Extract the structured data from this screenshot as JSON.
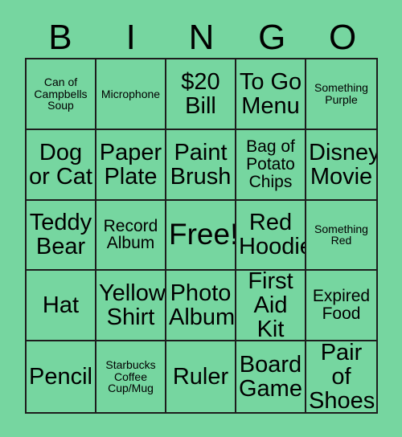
{
  "card": {
    "title": "BINGO",
    "background_color": "#76d6a0",
    "grid_line_color": "#1d1d1d",
    "text_color": "#000000",
    "header_letters": [
      "B",
      "I",
      "N",
      "G",
      "O"
    ],
    "rows": [
      [
        {
          "label": "Can of Campbells Soup",
          "size": "sm"
        },
        {
          "label": "Microphone",
          "size": "sm"
        },
        {
          "label": "$20 Bill",
          "size": "lg"
        },
        {
          "label": "To Go Menu",
          "size": "lg"
        },
        {
          "label": "Something Purple",
          "size": "sm"
        }
      ],
      [
        {
          "label": "Dog or Cat",
          "size": "lg"
        },
        {
          "label": "Paper Plate",
          "size": "lg"
        },
        {
          "label": "Paint Brush",
          "size": "lg"
        },
        {
          "label": "Bag of Potato Chips",
          "size": "md"
        },
        {
          "label": "Disney Movie",
          "size": "lg"
        }
      ],
      [
        {
          "label": "Teddy Bear",
          "size": "lg"
        },
        {
          "label": "Record Album",
          "size": "md"
        },
        {
          "label": "Free!",
          "size": "xl"
        },
        {
          "label": "Red Hoodie",
          "size": "lg"
        },
        {
          "label": "Something Red",
          "size": "sm"
        }
      ],
      [
        {
          "label": "Hat",
          "size": "lg"
        },
        {
          "label": "Yellow Shirt",
          "size": "lg"
        },
        {
          "label": "Photo Album",
          "size": "lg"
        },
        {
          "label": "First Aid Kit",
          "size": "lg"
        },
        {
          "label": "Expired Food",
          "size": "md"
        }
      ],
      [
        {
          "label": "Pencil",
          "size": "lg"
        },
        {
          "label": "Starbucks Coffee Cup/Mug",
          "size": "sm"
        },
        {
          "label": "Ruler",
          "size": "lg"
        },
        {
          "label": "Board Game",
          "size": "lg"
        },
        {
          "label": "Pair of Shoes",
          "size": "lg"
        }
      ]
    ]
  }
}
